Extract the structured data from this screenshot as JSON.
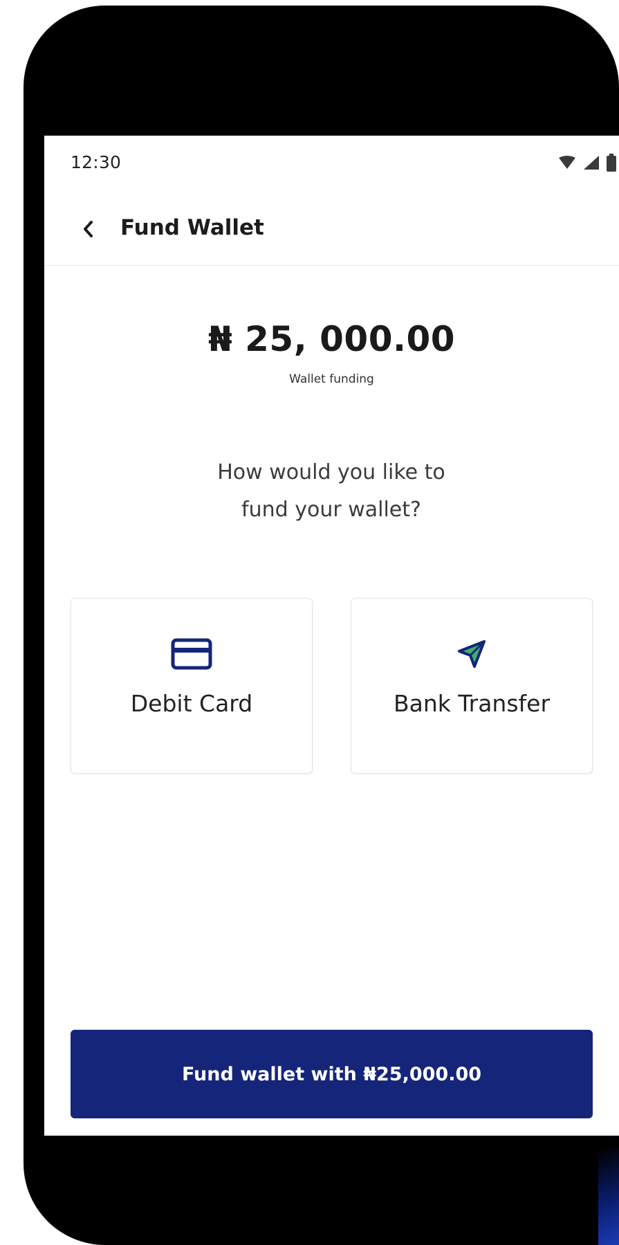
{
  "status_bar": {
    "time": "12:30",
    "icons": [
      "wifi-icon",
      "signal-icon",
      "battery-icon"
    ]
  },
  "app_bar": {
    "back_icon": "chevron-left-icon",
    "title": "Fund Wallet"
  },
  "summary": {
    "amount": "₦ 25, 000.00",
    "caption": "Wallet funding"
  },
  "prompt": {
    "line1": "How would you like to",
    "line2": "fund your wallet?"
  },
  "options": [
    {
      "label": "Debit Card",
      "icon": "credit-card-icon"
    },
    {
      "label": "Bank Transfer",
      "icon": "paper-plane-icon"
    }
  ],
  "cta": {
    "label": "Fund wallet with ₦25,000.00"
  },
  "colors": {
    "primary": "#15257a",
    "card_icon": "#15257a",
    "transfer_icon_fill": "#3fae6f",
    "transfer_icon_stroke": "#15257a",
    "bezel": "#000000"
  }
}
